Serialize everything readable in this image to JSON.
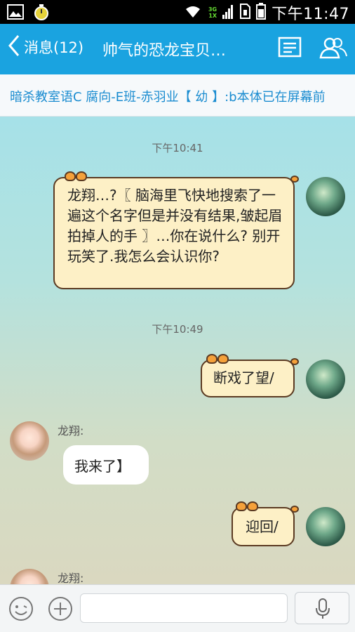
{
  "status_bar": {
    "time": "下午11:47",
    "network_top": "3G",
    "network_bottom": "1X"
  },
  "header": {
    "back_label": "消息(12)",
    "title": "帅气的恐龙宝贝…"
  },
  "notice": {
    "text": "暗杀教室语C 腐向-E班-赤羽业【 幼 】:b本体已在屏幕前"
  },
  "messages": {
    "ts1": "下午10:41",
    "msg1": "龙翔…?〖 脑海里飞快地搜索了一遍这个名字但是并没有结果,皱起眉拍掉人的手 〗…你在说什么? 别开玩笑了.我怎么会认识你?",
    "ts2": "下午10:49",
    "msg2": "断戏了望/",
    "sender_name": "龙翔:",
    "msg3": "我来了】",
    "msg4": "迎回/",
    "sender_name2": "龙翔:"
  },
  "colors": {
    "header_bg": "#1aa3e0",
    "notice_text": "#1a8cd0",
    "bubble_fill": "#fdf0c6",
    "bubble_border": "#5b3a22"
  }
}
